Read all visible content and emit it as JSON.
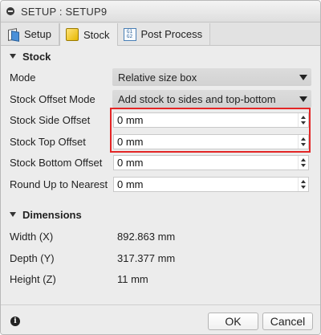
{
  "window": {
    "title": "SETUP : SETUP9"
  },
  "tabs": [
    {
      "label": "Setup",
      "icon": "setup-icon"
    },
    {
      "label": "Stock",
      "icon": "stock-icon"
    },
    {
      "label": "Post Process",
      "icon": "post-process-icon",
      "icon_text": "G1 G2"
    }
  ],
  "active_tab": "Stock",
  "stock": {
    "header": "Stock",
    "mode_label": "Mode",
    "mode_value": "Relative size box",
    "offset_mode_label": "Stock Offset Mode",
    "offset_mode_value": "Add stock to sides and top-bottom",
    "side_offset_label": "Stock Side Offset",
    "side_offset_value": "0 mm",
    "top_offset_label": "Stock Top Offset",
    "top_offset_value": "0 mm",
    "bottom_offset_label": "Stock Bottom Offset",
    "bottom_offset_value": "0 mm",
    "round_label": "Round Up to Nearest",
    "round_value": "0 mm"
  },
  "dimensions": {
    "header": "Dimensions",
    "width_label": "Width (X)",
    "width_value": "892.863 mm",
    "depth_label": "Depth (Y)",
    "depth_value": "317.377 mm",
    "height_label": "Height (Z)",
    "height_value": "11 mm"
  },
  "footer": {
    "info_glyph": "i",
    "ok_label": "OK",
    "cancel_label": "Cancel"
  },
  "colors": {
    "highlight": "#e32626",
    "window_bg": "#ececec"
  }
}
